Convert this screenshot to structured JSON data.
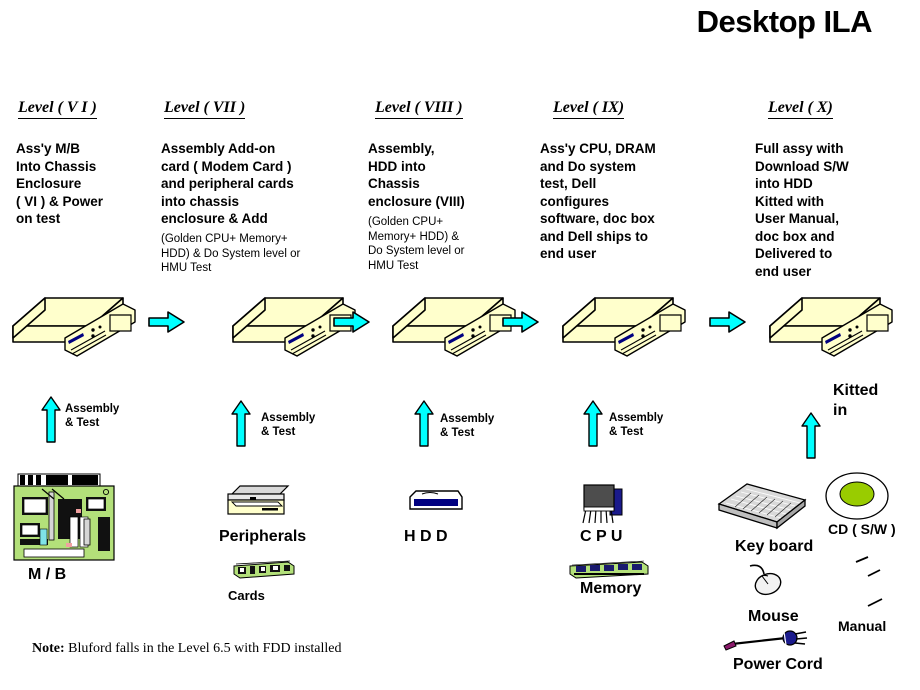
{
  "title": "Desktop ILA",
  "levels": [
    {
      "header": "Level  ( V I  )",
      "desc": "Ass'y  M/B\nInto  Chassis\nEnclosure\n( VI )  & Power\non test",
      "sub": "",
      "arrow_label": "Assembly\n& Test"
    },
    {
      "header": "Level ( VII )",
      "desc": "Assembly   Add-on\ncard ( Modem  Card )\nand  peripheral cards\ninto  chassis\nenclosure  & Add",
      "sub": "(Golden CPU+ Memory+\nHDD) & Do System level or\nHMU Test",
      "arrow_label": "Assembly\n&  Test"
    },
    {
      "header": "Level  ( VIII )",
      "desc": "Assembly,\nHDD into\nChassis\nenclosure  (VIII)",
      "sub": "(Golden CPU+\nMemory+ HDD) &\nDo System level or\nHMU Test",
      "arrow_label": "Assembly\n& Test"
    },
    {
      "header": "Level  ( IX)",
      "desc": "Ass'y  CPU, DRAM\nand  Do  system\ntest, Dell\nconfigures\nsoftware,  doc box\nand Dell ships  to\nend user",
      "sub": "",
      "arrow_label": "Assembly\n& Test"
    },
    {
      "header": "Level   ( X)",
      "desc": "Full assy with\nDownload  S/W\ninto HDD\nKitted with\nUser Manual,\ndoc box and\nDelivered to\nend user",
      "sub": "",
      "arrow_label": "Kitted\nin"
    }
  ],
  "parts": {
    "mb": "M / B",
    "peripherals": "Peripherals",
    "cards": "Cards",
    "hdd": "H D D",
    "cpu": "C P U",
    "memory": "Memory",
    "keyboard": "Key board",
    "mouse": "Mouse",
    "power_cord": "Power  Cord",
    "cd": "CD ( S/W )",
    "manual": "Manual"
  },
  "note": {
    "label": "Note:",
    "text": "Bluford  falls  in the  Level  6.5  with  FDD installed"
  },
  "colors": {
    "chassis_face": "#ffffcc",
    "chassis_top": "#ffffcc",
    "arrow_cyan": "#00ffff",
    "pcb_green": "#b3e07a",
    "cd_center": "#99cc00",
    "hdd_blue": "#000080",
    "outline": "#000000",
    "background": "#ffffff"
  }
}
